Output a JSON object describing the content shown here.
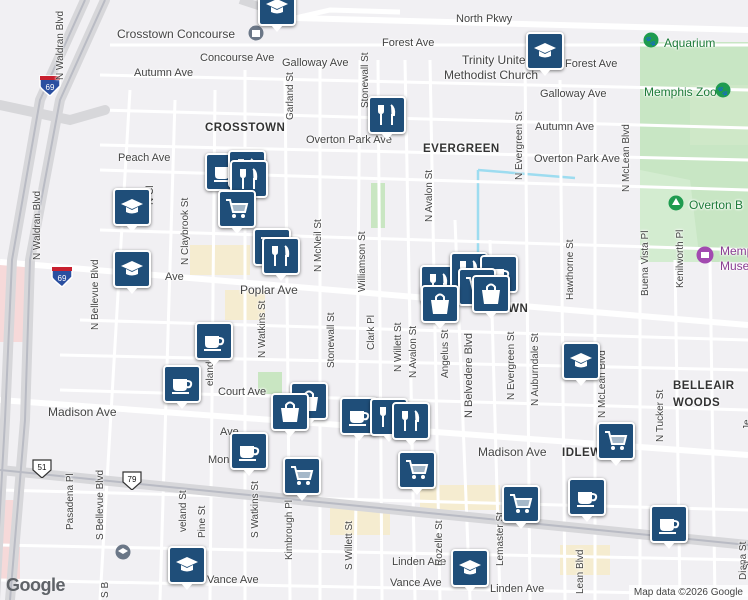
{
  "map": {
    "attribution": "Map data ©2026 Google",
    "logo_text": "Google",
    "highway_shields": [
      "69",
      "69",
      "51",
      "79"
    ],
    "neighborhoods": [
      "CROSSTOWN",
      "EVERGREEN",
      "BELLEAIR",
      "WOODS",
      "IDLEWI",
      "WTOWN"
    ],
    "pois": [
      "Crosstown Concourse",
      "Trinity United",
      "Methodist Church",
      "Aquarium",
      "Memphis Zoo",
      "Overton B",
      "Memp",
      "Muse"
    ],
    "street_labels_horizontal": [
      "North Pkwy",
      "Forest Ave",
      "Forest Ave",
      "Galloway Ave",
      "Galloway Ave",
      "Concourse Ave",
      "Autumn Ave",
      "Autumn Ave",
      "Overton Park Ave",
      "Overton Park Ave",
      "Peach Ave",
      "Poplar Ave",
      "Court Ave",
      "Madison Ave",
      "Madison Ave",
      "Mon",
      "Linden Ave",
      "Vance Ave",
      "Vance Ave",
      "Linden Ave",
      "Ave",
      "Ave"
    ],
    "street_labels_vertical": [
      "N Waldran Blvd",
      "N Waldran Blvd",
      "N Bellevue Blvd",
      "N Claybrook St",
      "N Watkins St",
      "N McNeil St",
      "Garland St",
      "Stonewall St",
      "Stonewall St",
      "Williamson St",
      "Clark Pl",
      "N Willett St",
      "N Avalon St",
      "N Avalon St",
      "Angelus St",
      "N Belvedere Blvd",
      "N Evergreen St",
      "N Evergreen St",
      "N Auburndale St",
      "Hawthorne St",
      "N McLean Blvd",
      "N McLean Blvd",
      "Buena Vista Pl",
      "Kenilworth Pl",
      "N Tucker St",
      "Pasadena Pl",
      "S Bellevue Blvd",
      "Pine St",
      "S Watkins St",
      "Kimbrough Pl",
      "S Willett St",
      "Rozelle St",
      "Lemaster St",
      "Lean Blvd",
      "Diana St",
      "veland St",
      "N Cl",
      "eland St",
      "S B",
      "Je",
      "St"
    ],
    "markers": [
      {
        "type": "school",
        "label": "school-icon"
      },
      {
        "type": "restaurant",
        "label": "restaurant-icon"
      },
      {
        "type": "cafe",
        "label": "cafe-icon"
      },
      {
        "type": "shopping-cart",
        "label": "shopping-cart-icon"
      },
      {
        "type": "shopping-bag",
        "label": "shopping-bag-icon"
      }
    ]
  }
}
